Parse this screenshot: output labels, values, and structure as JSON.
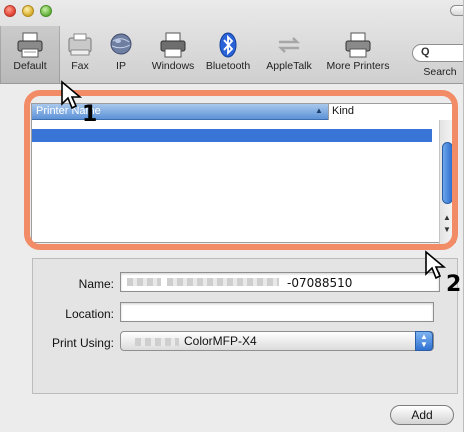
{
  "toolbar": {
    "items": [
      {
        "label": "Default",
        "icon": "printer-icon"
      },
      {
        "label": "Fax",
        "icon": "fax-icon"
      },
      {
        "label": "IP",
        "icon": "globe-icon"
      },
      {
        "label": "Windows",
        "icon": "printer-icon"
      },
      {
        "label": "Bluetooth",
        "icon": "bluetooth-icon"
      },
      {
        "label": "AppleTalk",
        "icon": "appletalk-arrows-icon"
      },
      {
        "label": "More Printers",
        "icon": "printer-icon"
      },
      {
        "label": "Search",
        "icon": "search-icon"
      }
    ],
    "search_glyph": "Q"
  },
  "printer_list": {
    "header": {
      "name": "Printer Name",
      "kind": "Kind",
      "sort_indicator": "▲"
    }
  },
  "details": {
    "name_label": "Name:",
    "name_value_suffix": "-07088510",
    "location_label": "Location:",
    "location_value": "",
    "print_using_label": "Print Using:",
    "print_using_value_suffix": "ColorMFP-X4"
  },
  "add_button": "Add",
  "annotations": {
    "step1": "1",
    "step2": "2"
  },
  "colors": {
    "highlight_frame": "#f28c67",
    "selection": "#3875d7",
    "aqua_blue": "#2f72d2"
  }
}
